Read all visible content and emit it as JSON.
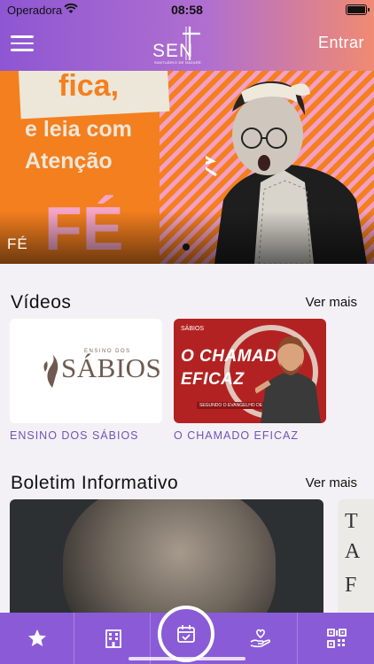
{
  "status_bar": {
    "carrier": "Operadora",
    "time": "08:58"
  },
  "header": {
    "logo_text": "SEN",
    "logo_subtitle": "SANTUÁRIO DE NAZARÉ",
    "login_label": "Entrar"
  },
  "hero": {
    "headline_1": "fica,",
    "headline_2": "e leia com",
    "headline_3": "Atenção",
    "big_word": "FÉ",
    "caption": "FÉ",
    "slides": 1,
    "active_slide": 1
  },
  "videos": {
    "title": "Vídeos",
    "see_more": "Ver mais",
    "items": [
      {
        "label": "ENSINO DOS SÁBIOS",
        "thumb_top": "ENSINO DOS",
        "thumb_word": "SÁBIOS"
      },
      {
        "label": "O CHAMADO EFICAZ",
        "thumb_logo": "SÁBIOS",
        "thumb_line1": "O CHAMADO",
        "thumb_line2": "EFICAZ",
        "thumb_sub": "SEGUNDO O EVANGELHO DE MATEUS"
      }
    ]
  },
  "bulletin": {
    "title": "Boletim Informativo",
    "see_more": "Ver mais",
    "next_card_letters": [
      "T",
      "A",
      "F"
    ]
  },
  "tabbar": {
    "tabs": [
      "star-icon",
      "building-icon",
      "calendar-check-icon",
      "hand-heart-icon",
      "qr-code-icon"
    ]
  },
  "colors": {
    "accent": "#8a5bd6",
    "label_purple": "#6f55b8",
    "header_gradient_start": "#8e56d2",
    "header_gradient_end": "#f08a72",
    "hero_orange": "#f47f1f",
    "hero_pink": "#f3a0c7"
  }
}
